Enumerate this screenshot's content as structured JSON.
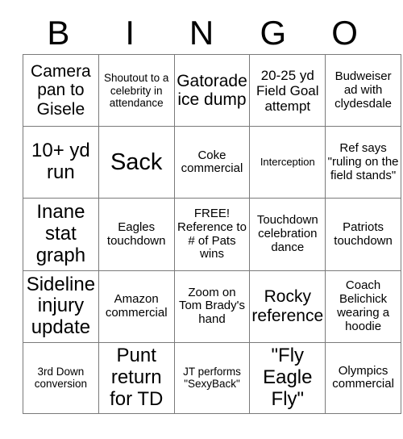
{
  "card": {
    "header_letters": [
      "B",
      "I",
      "N",
      "G",
      "O"
    ],
    "rows": [
      [
        "Camera pan to Gisele",
        "Shoutout to a celebrity in attendance",
        "Gatorade ice dump",
        "20-25 yd Field Goal attempt",
        "Budweiser ad with clydesdale"
      ],
      [
        "10+ yd run",
        "Sack",
        "Coke commercial",
        "Interception",
        "Ref says \"ruling on the field stands\""
      ],
      [
        "Inane stat graph",
        "Eagles touchdown",
        "FREE! Reference to # of Pats wins",
        "Touchdown celebration dance",
        "Patriots touchdown"
      ],
      [
        "Sideline injury update",
        "Amazon commercial",
        "Zoom on Tom Brady's hand",
        "Rocky reference",
        "Coach Belichick wearing a hoodie"
      ],
      [
        "3rd Down conversion",
        "Punt return for TD",
        "JT performs \"SexyBack\"",
        "\"Fly Eagle Fly\"",
        "Olympics commercial"
      ]
    ],
    "text_sizes": [
      [
        "fs-l",
        "fs-xs",
        "fs-l",
        "fs-m",
        "fs-s"
      ],
      [
        "fs-xl",
        "fs-xxl",
        "fs-s",
        "fs-xxs",
        "fs-s"
      ],
      [
        "fs-xl",
        "fs-s",
        "fs-s",
        "fs-s",
        "fs-s"
      ],
      [
        "fs-xl",
        "fs-s",
        "fs-s",
        "fs-l",
        "fs-s"
      ],
      [
        "fs-xs",
        "fs-xl",
        "fs-xs",
        "fs-xl",
        "fs-s"
      ]
    ],
    "colors": {
      "background": "#ffffff",
      "text": "#000000",
      "grid_line": "#7a7a7a"
    }
  }
}
